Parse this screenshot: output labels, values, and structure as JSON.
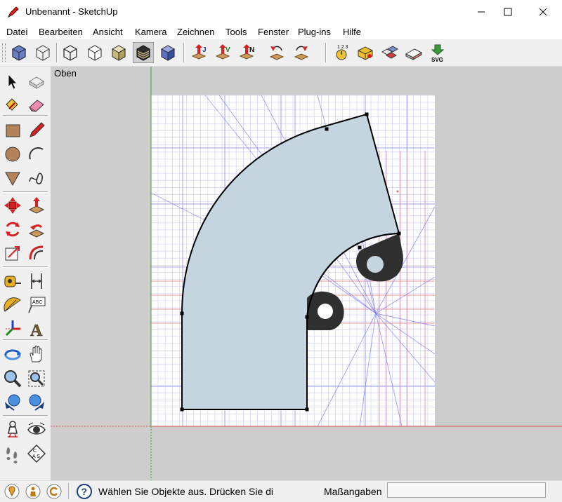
{
  "window": {
    "title": "Unbenannt - SketchUp"
  },
  "menu": {
    "items": [
      "Datei",
      "Bearbeiten",
      "Ansicht",
      "Kamera",
      "Zeichnen",
      "Tools",
      "Fenster",
      "Plug-ins",
      "Hilfe"
    ]
  },
  "toolbar": {
    "buttons": [
      {
        "name": "iso-view",
        "icon": "iso-view-icon"
      },
      {
        "name": "wireframe-box",
        "icon": "wireframe-box-icon"
      },
      {
        "name": "xray-style",
        "icon": "xray-style-icon"
      },
      {
        "name": "hidden-line-style",
        "icon": "hidden-line-style-icon"
      },
      {
        "name": "shaded-style",
        "icon": "shaded-style-icon"
      },
      {
        "name": "shaded-textures-style",
        "icon": "shaded-textures-style-icon",
        "active": true
      },
      {
        "name": "monochrome-style",
        "icon": "monochrome-style-icon"
      },
      {
        "name": "extension-j",
        "icon": "extension-j-icon"
      },
      {
        "name": "extension-v",
        "icon": "extension-v-icon"
      },
      {
        "name": "extension-n",
        "icon": "extension-n-icon"
      },
      {
        "name": "rotate-ccw-tool",
        "icon": "rotate-ccw-icon"
      },
      {
        "name": "rotate-cw-tool",
        "icon": "rotate-cw-icon"
      },
      {
        "name": "stopwatch",
        "icon": "stopwatch-icon"
      },
      {
        "name": "measure-block",
        "icon": "measure-block-icon"
      },
      {
        "name": "component-tool",
        "icon": "component-icon"
      },
      {
        "name": "eraser-block",
        "icon": "eraser-block-icon"
      },
      {
        "name": "export-svg",
        "icon": "svg-export-icon",
        "label": "SVG"
      }
    ]
  },
  "viewport": {
    "view_name": "Oben",
    "face_color": "#c5d5e0",
    "grid_color": "#d8d8f4",
    "axis_red": "#e05050",
    "axis_green": "#3c9a3c",
    "guide_blue": "#6f6ff0"
  },
  "left_tools": [
    "select-arrow-icon",
    "make-component-icon",
    "paint-bucket-icon",
    "eraser-icon",
    "rectangle-icon",
    "pencil-icon",
    "circle-icon",
    "arc-icon",
    "polygon-icon",
    "freehand-icon",
    "move-icon",
    "push-pull-icon",
    "rotate-icon",
    "follow-me-icon",
    "scale-icon",
    "offset-icon",
    "tape-measure-icon",
    "dimension-icon",
    "protractor-icon",
    "text-label-icon",
    "axes-icon",
    "3d-text-icon",
    "orbit-icon",
    "pan-hand-icon",
    "zoom-icon",
    "zoom-window-icon",
    "previous-view-icon",
    "next-view-icon",
    "position-camera-icon",
    "look-around-icon",
    "walk-icon",
    "section-plane-icon"
  ],
  "statusbar": {
    "message": "Wählen Sie Objekte aus. Drücken Sie di",
    "measure_label": "Maßangaben",
    "measure_value": "",
    "icons": [
      "geo-location-icon",
      "credits-icon",
      "copyright-icon",
      "help-icon"
    ]
  }
}
